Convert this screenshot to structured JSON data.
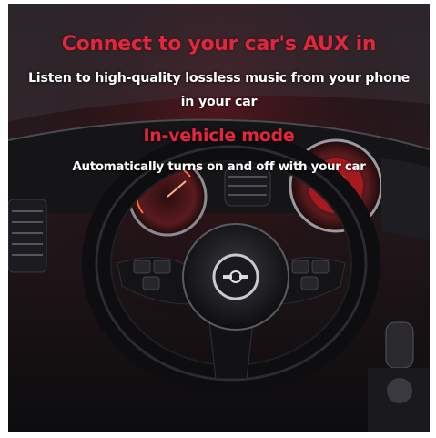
{
  "image": {
    "headline": "Connect to your car's AUX in",
    "subheadline_line1": "Listen to high-quality lossless music from your phone",
    "subheadline_line2": "in your car",
    "mode_title": "In-vehicle mode",
    "mode_description": "Automatically turns on and off with your car"
  },
  "colors": {
    "accent_red": "#e3263c",
    "text_white": "#ffffff",
    "background_dark": "#0a0a0c"
  },
  "icons": [
    "steering-wheel-logo-icon"
  ]
}
